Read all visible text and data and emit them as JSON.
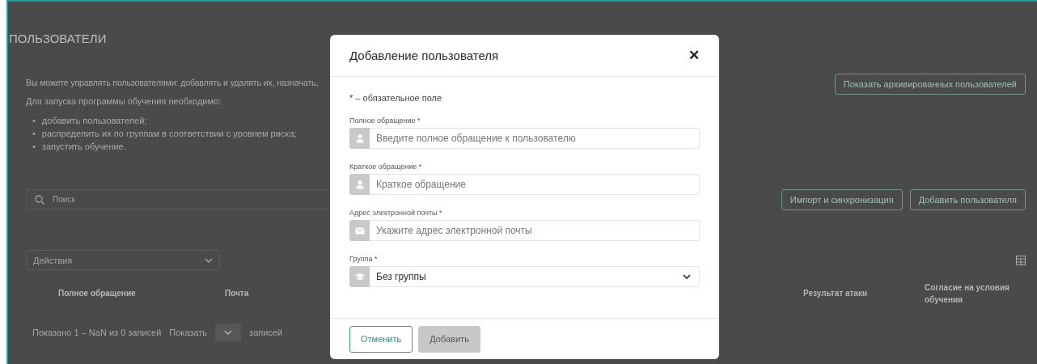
{
  "page": {
    "title": "ПОЛЬЗОВАТЕЛИ",
    "intro": "Вы можете управлять пользователями: добавлять и удалять их, назначать,",
    "steps_heading": "Для запуска программы обучения необходимо:",
    "bullet": "•",
    "steps": [
      "добавить пользователей;",
      "распределить их по группам в соответствии с уровнем риска;",
      "запустить обучение."
    ],
    "archive_button": "Показать архивированных пользователей",
    "search": {
      "placeholder": "Поиск"
    },
    "import_button": "Импорт и синхронизация",
    "add_button": "Добавить пользователя",
    "actions": {
      "value": "Действия"
    },
    "table": {
      "columns": [
        "Полное обращение",
        "Почта",
        "Результат атаки",
        "Согласие на условия обучения"
      ]
    },
    "footer": {
      "summary": "Показано 1 – NaN из 0 записей",
      "show_label": "Показать",
      "per_page_suffix": "записей"
    }
  },
  "modal": {
    "title": "Добавление пользователя",
    "close": "✕",
    "required_note": "* – обязательное поле",
    "fields": [
      {
        "kind": "name",
        "label": "Полное обращение *",
        "placeholder": "Введите полное обращение к пользователю"
      },
      {
        "kind": "name",
        "label": "Краткое обращение *",
        "placeholder": "Краткое обращение"
      },
      {
        "kind": "email",
        "label": "Адрес электронной почты *",
        "placeholder": "Укажите адрес электронной почты"
      },
      {
        "kind": "group",
        "label": "Группа *",
        "value": "Без группы"
      }
    ],
    "buttons": [
      {
        "label": "Отменить",
        "kind": "secondary",
        "disabled": false
      },
      {
        "label": "Добавить",
        "kind": "primary",
        "disabled": true
      }
    ]
  }
}
